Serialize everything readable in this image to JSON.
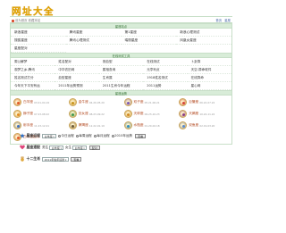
{
  "logo": "网址大全",
  "header": {
    "left_text": "设为首页 收藏本站",
    "right_links": [
      "首页",
      "星座"
    ]
  },
  "sections": [
    {
      "title": "星座站点",
      "cols": 4,
      "items": [
        "新浪星座",
        "腾讯星座",
        "第1星座",
        "新浪心理测试",
        "搜狐星座",
        "腾讯心理测试",
        "瑞丽星座",
        "凤凰女星座",
        "星座配对"
      ]
    },
    {
      "title": "在线测试工具",
      "cols": 5,
      "items": [
        "周公解梦",
        "姓名配对",
        "测血型",
        "在线测试",
        "卜卦算",
        "观梦之乡-腾讯",
        "中华农历网",
        "属相查询",
        "元亨利贞",
        "天空-算命软件",
        "姓名测试打分",
        "血型星座",
        "生肖属",
        "1918姓名测试",
        "在线算命",
        "今年天下平安有运",
        "2011年运势预测",
        "2011生肖今年运程",
        "2011运势",
        "星心网"
      ]
    }
  ],
  "zodiac": {
    "title": "星座运势",
    "items": [
      {
        "name": "白羊座",
        "date": "03.21-04.19",
        "icon": "aries-icon",
        "color": "#e05a2a"
      },
      {
        "name": "金牛座",
        "date": "04.20-05.20",
        "icon": "taurus-icon",
        "color": "#c9941d"
      },
      {
        "name": "双子座",
        "date": "05.21-06.21",
        "icon": "gemini-icon",
        "color": "#7a58b8"
      },
      {
        "name": "巨蟹座",
        "date": "06.22-07.22",
        "icon": "cancer-icon",
        "color": "#d6453a"
      },
      {
        "name": "狮子座",
        "date": "07.23-08.22",
        "icon": "leo-icon",
        "color": "#e08a1f"
      },
      {
        "name": "处女座",
        "date": "08.23-09.22",
        "icon": "virgo-icon",
        "color": "#3f9a52"
      },
      {
        "name": "天秤座",
        "date": "09.23-10.23",
        "icon": "libra-icon",
        "color": "#d08a22"
      },
      {
        "name": "天蝎座",
        "date": "10.24-11.22",
        "icon": "scorpio-icon",
        "color": "#8a3d8a"
      },
      {
        "name": "射手座",
        "date": "11.23-12.21",
        "icon": "sagittarius-icon",
        "color": "#3d6fbf"
      },
      {
        "name": "摩羯座",
        "date": "12.22-01.19",
        "icon": "capricorn-icon",
        "color": "#6b5a3a"
      },
      {
        "name": "水瓶座",
        "date": "01.20-02.18",
        "icon": "aquarius-icon",
        "color": "#2f8fbf"
      },
      {
        "name": "双鱼座",
        "date": "02.19-03.20",
        "icon": "pisces-icon",
        "color": "#5a8bd0"
      },
      {
        "name": "白羊座配对",
        "date": "",
        "icon": "aries-icon",
        "color": "#e05a2a"
      }
    ]
  },
  "tools": {
    "horoscope": {
      "label": "星座运程",
      "select_value": "白羊座",
      "options": [
        "今日运程",
        "每周运程",
        "每月运程",
        "2010年运势"
      ],
      "selected_index": 0,
      "button": "查看"
    },
    "match": {
      "label": "星座速配",
      "male_label": "男生",
      "male_value": "白羊座",
      "female_label": "女生",
      "female_value": "白羊座",
      "button": "配对"
    },
    "shengxiao": {
      "label": "十二生肖",
      "select_value": "2011年兔年运势",
      "button": "查看"
    }
  },
  "colors": {
    "accent_green": "#d8ecd8",
    "link_red": "#b2481f",
    "logo_gold": "#e0a300"
  }
}
